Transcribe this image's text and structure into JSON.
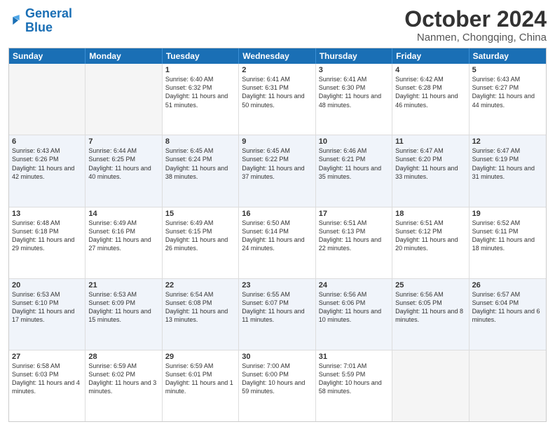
{
  "header": {
    "logo_general": "General",
    "logo_blue": "Blue",
    "month": "October 2024",
    "location": "Nanmen, Chongqing, China"
  },
  "days_of_week": [
    "Sunday",
    "Monday",
    "Tuesday",
    "Wednesday",
    "Thursday",
    "Friday",
    "Saturday"
  ],
  "weeks": [
    [
      {
        "day": "",
        "sunrise": "",
        "sunset": "",
        "daylight": "",
        "empty": true
      },
      {
        "day": "",
        "sunrise": "",
        "sunset": "",
        "daylight": "",
        "empty": true
      },
      {
        "day": "1",
        "sunrise": "Sunrise: 6:40 AM",
        "sunset": "Sunset: 6:32 PM",
        "daylight": "Daylight: 11 hours and 51 minutes.",
        "empty": false
      },
      {
        "day": "2",
        "sunrise": "Sunrise: 6:41 AM",
        "sunset": "Sunset: 6:31 PM",
        "daylight": "Daylight: 11 hours and 50 minutes.",
        "empty": false
      },
      {
        "day": "3",
        "sunrise": "Sunrise: 6:41 AM",
        "sunset": "Sunset: 6:30 PM",
        "daylight": "Daylight: 11 hours and 48 minutes.",
        "empty": false
      },
      {
        "day": "4",
        "sunrise": "Sunrise: 6:42 AM",
        "sunset": "Sunset: 6:28 PM",
        "daylight": "Daylight: 11 hours and 46 minutes.",
        "empty": false
      },
      {
        "day": "5",
        "sunrise": "Sunrise: 6:43 AM",
        "sunset": "Sunset: 6:27 PM",
        "daylight": "Daylight: 11 hours and 44 minutes.",
        "empty": false
      }
    ],
    [
      {
        "day": "6",
        "sunrise": "Sunrise: 6:43 AM",
        "sunset": "Sunset: 6:26 PM",
        "daylight": "Daylight: 11 hours and 42 minutes.",
        "empty": false
      },
      {
        "day": "7",
        "sunrise": "Sunrise: 6:44 AM",
        "sunset": "Sunset: 6:25 PM",
        "daylight": "Daylight: 11 hours and 40 minutes.",
        "empty": false
      },
      {
        "day": "8",
        "sunrise": "Sunrise: 6:45 AM",
        "sunset": "Sunset: 6:24 PM",
        "daylight": "Daylight: 11 hours and 38 minutes.",
        "empty": false
      },
      {
        "day": "9",
        "sunrise": "Sunrise: 6:45 AM",
        "sunset": "Sunset: 6:22 PM",
        "daylight": "Daylight: 11 hours and 37 minutes.",
        "empty": false
      },
      {
        "day": "10",
        "sunrise": "Sunrise: 6:46 AM",
        "sunset": "Sunset: 6:21 PM",
        "daylight": "Daylight: 11 hours and 35 minutes.",
        "empty": false
      },
      {
        "day": "11",
        "sunrise": "Sunrise: 6:47 AM",
        "sunset": "Sunset: 6:20 PM",
        "daylight": "Daylight: 11 hours and 33 minutes.",
        "empty": false
      },
      {
        "day": "12",
        "sunrise": "Sunrise: 6:47 AM",
        "sunset": "Sunset: 6:19 PM",
        "daylight": "Daylight: 11 hours and 31 minutes.",
        "empty": false
      }
    ],
    [
      {
        "day": "13",
        "sunrise": "Sunrise: 6:48 AM",
        "sunset": "Sunset: 6:18 PM",
        "daylight": "Daylight: 11 hours and 29 minutes.",
        "empty": false
      },
      {
        "day": "14",
        "sunrise": "Sunrise: 6:49 AM",
        "sunset": "Sunset: 6:16 PM",
        "daylight": "Daylight: 11 hours and 27 minutes.",
        "empty": false
      },
      {
        "day": "15",
        "sunrise": "Sunrise: 6:49 AM",
        "sunset": "Sunset: 6:15 PM",
        "daylight": "Daylight: 11 hours and 26 minutes.",
        "empty": false
      },
      {
        "day": "16",
        "sunrise": "Sunrise: 6:50 AM",
        "sunset": "Sunset: 6:14 PM",
        "daylight": "Daylight: 11 hours and 24 minutes.",
        "empty": false
      },
      {
        "day": "17",
        "sunrise": "Sunrise: 6:51 AM",
        "sunset": "Sunset: 6:13 PM",
        "daylight": "Daylight: 11 hours and 22 minutes.",
        "empty": false
      },
      {
        "day": "18",
        "sunrise": "Sunrise: 6:51 AM",
        "sunset": "Sunset: 6:12 PM",
        "daylight": "Daylight: 11 hours and 20 minutes.",
        "empty": false
      },
      {
        "day": "19",
        "sunrise": "Sunrise: 6:52 AM",
        "sunset": "Sunset: 6:11 PM",
        "daylight": "Daylight: 11 hours and 18 minutes.",
        "empty": false
      }
    ],
    [
      {
        "day": "20",
        "sunrise": "Sunrise: 6:53 AM",
        "sunset": "Sunset: 6:10 PM",
        "daylight": "Daylight: 11 hours and 17 minutes.",
        "empty": false
      },
      {
        "day": "21",
        "sunrise": "Sunrise: 6:53 AM",
        "sunset": "Sunset: 6:09 PM",
        "daylight": "Daylight: 11 hours and 15 minutes.",
        "empty": false
      },
      {
        "day": "22",
        "sunrise": "Sunrise: 6:54 AM",
        "sunset": "Sunset: 6:08 PM",
        "daylight": "Daylight: 11 hours and 13 minutes.",
        "empty": false
      },
      {
        "day": "23",
        "sunrise": "Sunrise: 6:55 AM",
        "sunset": "Sunset: 6:07 PM",
        "daylight": "Daylight: 11 hours and 11 minutes.",
        "empty": false
      },
      {
        "day": "24",
        "sunrise": "Sunrise: 6:56 AM",
        "sunset": "Sunset: 6:06 PM",
        "daylight": "Daylight: 11 hours and 10 minutes.",
        "empty": false
      },
      {
        "day": "25",
        "sunrise": "Sunrise: 6:56 AM",
        "sunset": "Sunset: 6:05 PM",
        "daylight": "Daylight: 11 hours and 8 minutes.",
        "empty": false
      },
      {
        "day": "26",
        "sunrise": "Sunrise: 6:57 AM",
        "sunset": "Sunset: 6:04 PM",
        "daylight": "Daylight: 11 hours and 6 minutes.",
        "empty": false
      }
    ],
    [
      {
        "day": "27",
        "sunrise": "Sunrise: 6:58 AM",
        "sunset": "Sunset: 6:03 PM",
        "daylight": "Daylight: 11 hours and 4 minutes.",
        "empty": false
      },
      {
        "day": "28",
        "sunrise": "Sunrise: 6:59 AM",
        "sunset": "Sunset: 6:02 PM",
        "daylight": "Daylight: 11 hours and 3 minutes.",
        "empty": false
      },
      {
        "day": "29",
        "sunrise": "Sunrise: 6:59 AM",
        "sunset": "Sunset: 6:01 PM",
        "daylight": "Daylight: 11 hours and 1 minute.",
        "empty": false
      },
      {
        "day": "30",
        "sunrise": "Sunrise: 7:00 AM",
        "sunset": "Sunset: 6:00 PM",
        "daylight": "Daylight: 10 hours and 59 minutes.",
        "empty": false
      },
      {
        "day": "31",
        "sunrise": "Sunrise: 7:01 AM",
        "sunset": "Sunset: 5:59 PM",
        "daylight": "Daylight: 10 hours and 58 minutes.",
        "empty": false
      },
      {
        "day": "",
        "sunrise": "",
        "sunset": "",
        "daylight": "",
        "empty": true
      },
      {
        "day": "",
        "sunrise": "",
        "sunset": "",
        "daylight": "",
        "empty": true
      }
    ]
  ]
}
